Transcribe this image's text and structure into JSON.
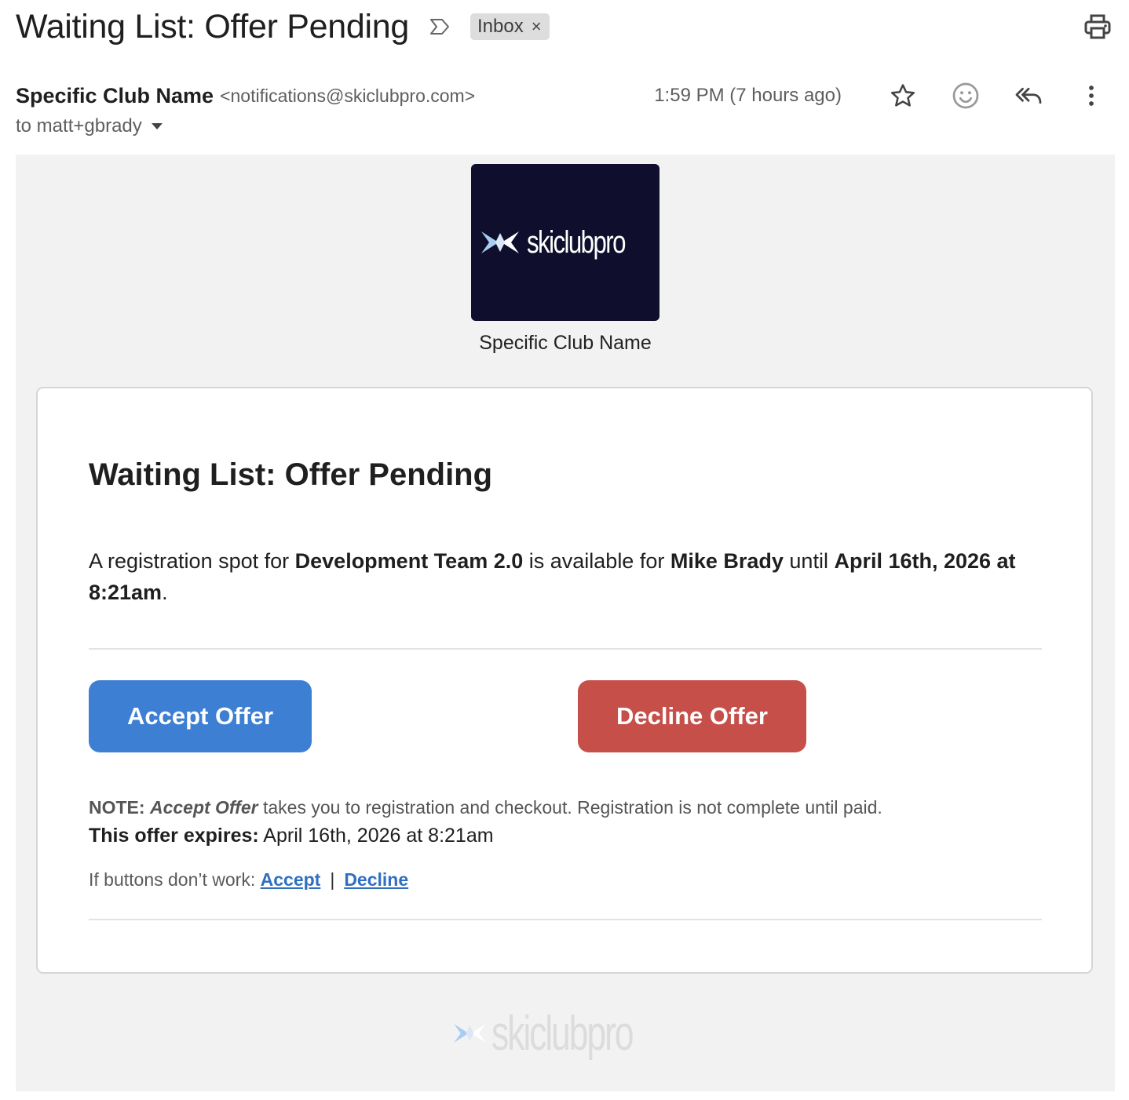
{
  "email": {
    "subject": "Waiting List: Offer Pending",
    "label": "Inbox",
    "label_remove": "×",
    "sender_name": "Specific Club Name",
    "sender_email": "<notifications@skiclubpro.com>",
    "timestamp": "1:59 PM (7 hours ago)",
    "to": "to matt+gbrady",
    "icons": [
      "importance-marker-icon",
      "printer-icon",
      "star-icon",
      "emoji-reaction-icon",
      "reply-all-icon",
      "more-vertical-icon",
      "chevron-down-icon"
    ]
  },
  "body": {
    "logo_text": "skiclubpro",
    "club_name": "Specific Club Name",
    "card": {
      "title": "Waiting List: Offer Pending",
      "text_1": "A registration spot for ",
      "program": "Development Team 2.0",
      "text_2": " is available for ",
      "person": "Mike Brady",
      "text_3": " until ",
      "deadline": "April 16th, 2026 at 8:21am",
      "text_4": ".",
      "accept_label": "Accept Offer",
      "decline_label": "Decline Offer",
      "note_label": "NOTE:",
      "note_emph": "Accept Offer",
      "note_rest": " takes you to registration and checkout. Registration is not complete until paid.",
      "expires_label": "This offer expires:",
      "expires_value": " April 16th, 2026 at 8:21am",
      "fallback_text": "If buttons don’t work: ",
      "fallback_accept": "Accept",
      "fallback_sep": "|",
      "fallback_decline": "Decline"
    },
    "footer_logo_text": "skiclubpro"
  },
  "colors": {
    "accept": "#3d7fd2",
    "decline": "#c64f4a",
    "logo_bg": "#0f0f2d",
    "logo_mark": "#a9cdf0",
    "link": "#2f6fc0"
  }
}
